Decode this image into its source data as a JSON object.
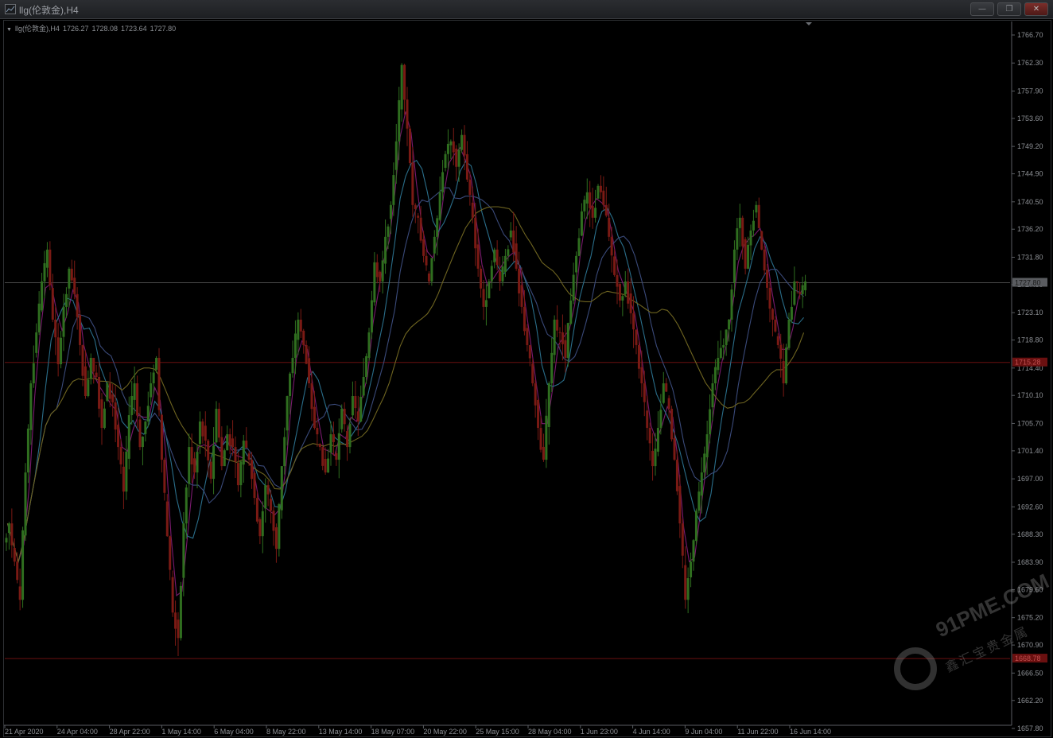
{
  "window": {
    "title": "llg(伦敦金),H4",
    "buttons": {
      "minimize": "—",
      "restore": "❐",
      "close": "✕"
    }
  },
  "info": {
    "symbol": "llg(伦敦金),H4",
    "open": "1726.27",
    "high": "1728.08",
    "low": "1723.64",
    "close": "1727.80"
  },
  "price_labels": {
    "current": "1727.80",
    "level_1": "1715.28",
    "level_2": "1668.78"
  },
  "watermark": {
    "text": "91PME.COM",
    "sub": "鑫汇宝贵金属"
  },
  "colors": {
    "bull": "#2f6e1f",
    "bear": "#7a1a14",
    "level": "#6a1010",
    "current_line": "#4a4a4a",
    "ma_fast": "#7a1a6e",
    "ma_mid": "#2a6e8a",
    "ma_slow": "#3a4a7a",
    "ma_long": "#6e6420",
    "axis_text": "#8c8f94"
  },
  "chart_data": {
    "type": "candlestick",
    "symbol": "llg(伦敦金)",
    "timeframe": "H4",
    "y_ticks": [
      "1766.70",
      "1762.30",
      "1757.90",
      "1753.60",
      "1749.20",
      "1744.90",
      "1740.50",
      "1736.20",
      "1731.80",
      "1727.50",
      "1723.10",
      "1718.80",
      "1714.40",
      "1710.10",
      "1705.70",
      "1701.40",
      "1697.00",
      "1692.60",
      "1688.30",
      "1683.90",
      "1679.60",
      "1675.20",
      "1670.90",
      "1666.50",
      "1662.20",
      "1657.80"
    ],
    "ylim": [
      1657.8,
      1766.7
    ],
    "x_ticks": [
      "21 Apr 2020",
      "24 Apr 04:00",
      "28 Apr 22:00",
      "1 May 14:00",
      "6 May 04:00",
      "8 May 22:00",
      "13 May 14:00",
      "18 May 07:00",
      "20 May 22:00",
      "25 May 15:00",
      "28 May 04:00",
      "1 Jun 23:00",
      "4 Jun 14:00",
      "9 Jun 04:00",
      "11 Jun 22:00",
      "16 Jun 14:00"
    ],
    "horizontal_lines": [
      {
        "price": 1727.8,
        "kind": "current"
      },
      {
        "price": 1715.28,
        "kind": "level"
      },
      {
        "price": 1668.78,
        "kind": "level"
      }
    ],
    "close_series": [
      1690,
      1684,
      1678,
      1698,
      1712,
      1720,
      1728,
      1733,
      1722,
      1715,
      1724,
      1730,
      1726,
      1718,
      1710,
      1716,
      1713,
      1705,
      1712,
      1709,
      1702,
      1695,
      1707,
      1712,
      1702,
      1706,
      1712,
      1716,
      1700,
      1688,
      1676,
      1672,
      1690,
      1702,
      1698,
      1706,
      1703,
      1697,
      1708,
      1699,
      1704,
      1702,
      1696,
      1703,
      1700,
      1694,
      1688,
      1696,
      1692,
      1686,
      1699,
      1710,
      1716,
      1722,
      1718,
      1712,
      1705,
      1702,
      1698,
      1704,
      1700,
      1708,
      1702,
      1710,
      1706,
      1713,
      1720,
      1731,
      1728,
      1735,
      1740,
      1750,
      1762,
      1752,
      1740,
      1738,
      1732,
      1728,
      1735,
      1742,
      1748,
      1750,
      1746,
      1751,
      1744,
      1738,
      1730,
      1724,
      1728,
      1733,
      1728,
      1732,
      1736,
      1730,
      1724,
      1718,
      1712,
      1705,
      1700,
      1712,
      1722,
      1720,
      1716,
      1725,
      1732,
      1739,
      1742,
      1738,
      1743,
      1740,
      1735,
      1729,
      1725,
      1728,
      1723,
      1718,
      1712,
      1705,
      1699,
      1705,
      1712,
      1708,
      1700,
      1690,
      1678,
      1684,
      1692,
      1698,
      1704,
      1712,
      1716,
      1718,
      1722,
      1733,
      1738,
      1730,
      1736,
      1740,
      1733,
      1727,
      1722,
      1718,
      1712,
      1722,
      1728,
      1726,
      1728
    ]
  }
}
